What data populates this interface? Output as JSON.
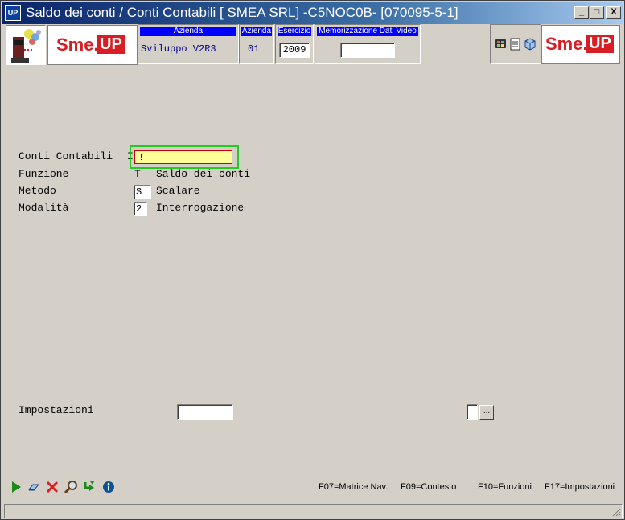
{
  "window": {
    "title": "Saldo dei conti / Conti Contabili [ SMEA SRL] -C5NOC0B- [070095-5-1]",
    "app_icon": "UP",
    "minimize": "_",
    "maximize": "□",
    "close": "X"
  },
  "header": {
    "logo_left": {
      "sme": "Sme.",
      "up": "UP"
    },
    "logo_right": {
      "sme": "Sme.",
      "up": "UP"
    },
    "azienda_desc_label": "Azienda",
    "azienda_desc_value": "Sviluppo V2R3",
    "azienda_code_label": "Azienda",
    "azienda_code_value": "01",
    "esercizio_label": "Esercizio",
    "esercizio_value": "2009",
    "memorizzazione_label": "Memorizzazione Dati Video",
    "memorizzazione_value": ""
  },
  "form": {
    "conti_label": "Conti Contabili",
    "conti_marker": "I",
    "conti_value": "!",
    "funzione_label": "Funzione",
    "funzione_code": "T",
    "funzione_desc": "Saldo dei conti",
    "metodo_label": "Metodo",
    "metodo_value": "S",
    "metodo_desc": "Scalare",
    "modalita_label": "Modalità",
    "modalita_value": "2",
    "modalita_desc": "Interrogazione",
    "impostazioni_label": "Impostazioni",
    "impostazioni_value": "",
    "browse_button": "..."
  },
  "function_keys": [
    "F07=Matrice Nav.",
    "F09=Contesto",
    "F10=Funzioni",
    "F17=Impostazioni"
  ],
  "colors": {
    "accent_blue": "#0000ff",
    "brand_red": "#d81e24",
    "focus_green": "#22cc22",
    "input_yellow": "#ffff99"
  }
}
